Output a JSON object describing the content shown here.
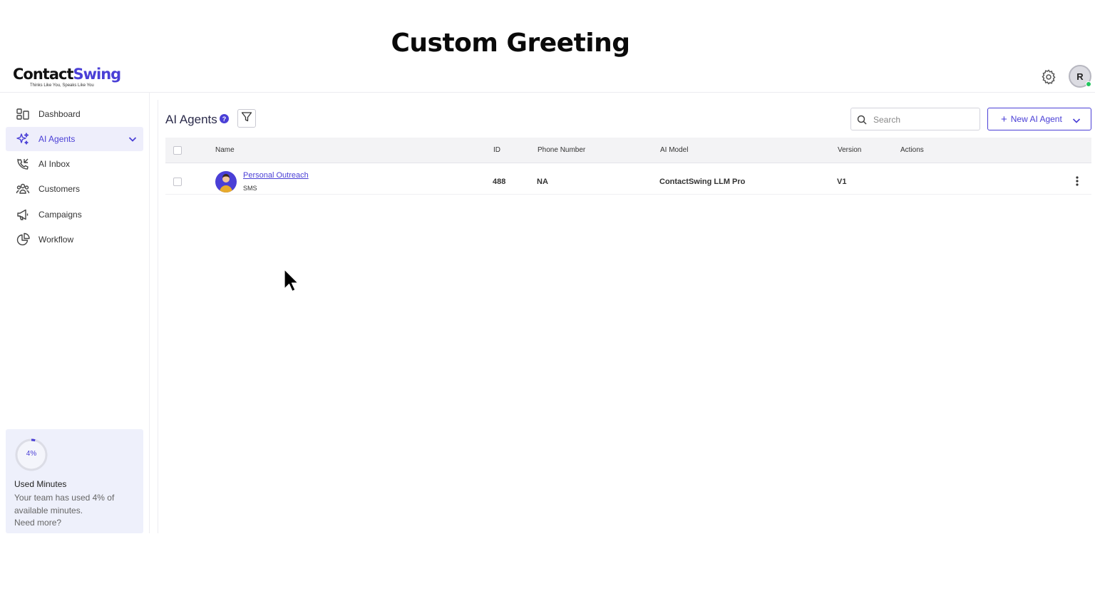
{
  "banner": {
    "title": "Custom Greeting"
  },
  "brand": {
    "name_part1": "Contact",
    "name_part2": "Swing",
    "tagline": "Thinks Like You, Speaks Like You",
    "accent": "#4a3fd6"
  },
  "header": {
    "avatar_initial": "R",
    "status_color": "#22c55e"
  },
  "sidebar": {
    "items": [
      {
        "label": "Dashboard",
        "icon": "dashboard-icon"
      },
      {
        "label": "AI Agents",
        "icon": "sparkles-icon",
        "active": true
      },
      {
        "label": "AI Inbox",
        "icon": "phone-incoming-icon"
      },
      {
        "label": "Customers",
        "icon": "users-icon"
      },
      {
        "label": "Campaigns",
        "icon": "megaphone-icon"
      },
      {
        "label": "Workflow",
        "icon": "pie-chart-icon"
      }
    ],
    "usage": {
      "percent_label": "4%",
      "percent": 4,
      "title": "Used Minutes",
      "description": "Your team has used 4% of available minutes.",
      "more": "Need more?"
    }
  },
  "main": {
    "title": "AI Agents",
    "help": "?",
    "search_placeholder": "Search",
    "new_button": "New AI Agent",
    "columns": [
      "Name",
      "ID",
      "Phone Number",
      "AI Model",
      "Version",
      "Actions"
    ],
    "rows": [
      {
        "name": "Personal Outreach",
        "channel": "SMS",
        "id": "488",
        "phone": "NA",
        "model": "ContactSwing LLM Pro",
        "version": "V1"
      }
    ]
  }
}
